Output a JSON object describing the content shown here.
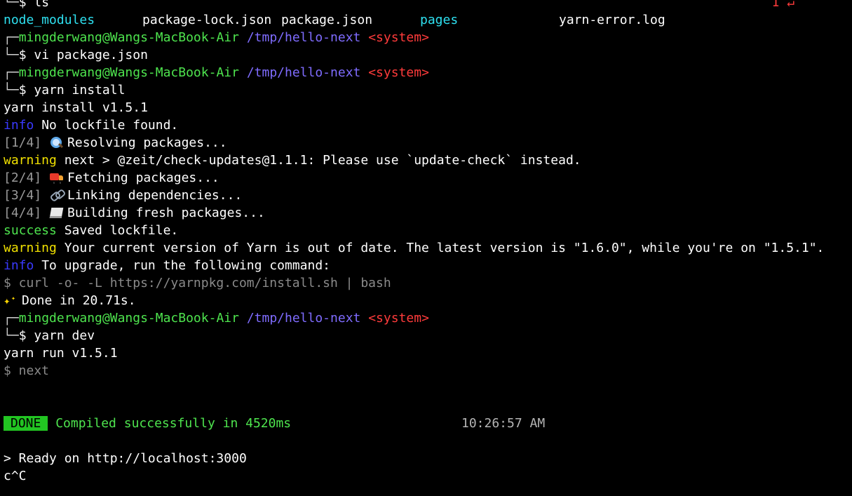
{
  "prompt": {
    "top": "┌─",
    "bottom": "└─",
    "dollar": "$",
    "user_host": "mingderwang@Wangs-MacBook-Air",
    "path": "/tmp/hello-next",
    "env": "<system>"
  },
  "lines": {
    "ls_cmd": "ls",
    "ls_exit": "1 ↵",
    "ls_output": {
      "node_modules": "node_modules",
      "package_lock": "package-lock.json",
      "package_json": "package.json",
      "pages": "pages",
      "yarn_error": "yarn-error.log"
    },
    "vi_cmd": "vi package.json",
    "yarn_install_cmd": "yarn install",
    "yarn_install_version": "yarn install v1.5.1",
    "info_label": "info",
    "no_lockfile": "No lockfile found.",
    "step1_tag": "[1/4]",
    "step1_text": "Resolving packages...",
    "warning_label": "warning",
    "warn_next": "next > @zeit/check-updates@1.1.1: Please use `update-check` instead.",
    "step2_tag": "[2/4]",
    "step2_text": "Fetching packages...",
    "step3_tag": "[3/4]",
    "step3_text": "Linking dependencies...",
    "step4_tag": "[4/4]",
    "step4_text": "Building fresh packages...",
    "success_label": "success",
    "saved_lockfile": "Saved lockfile.",
    "warn_yarn": "Your current version of Yarn is out of date. The latest version is \"1.6.0\", while you're on \"1.5.1\".",
    "info_upgrade": "To upgrade, run the following command:",
    "curl_cmd": "$ curl -o- -L https://yarnpkg.com/install.sh | bash",
    "done_text": "Done in 20.71s.",
    "yarn_dev_cmd": "yarn dev",
    "yarn_run_version": "yarn run v1.5.1",
    "next_cmd": "$ next",
    "done_badge": "DONE",
    "compiled": "Compiled successfully in 4520ms",
    "compiled_time": "10:26:57 AM",
    "ready": "> Ready on http://localhost:3000",
    "interrupt": "c^C"
  },
  "colors": {
    "background": "#000000",
    "user_host": "#4ee44e",
    "path": "#7f6cff",
    "env": "#ff3b3b",
    "directory": "#2ee0f0",
    "info": "#3a3aff",
    "warning": "#f0e000",
    "success": "#4ee44e",
    "done_badge": "#22c522"
  },
  "icons": {
    "step1": "magnifying-glass-icon",
    "step2": "delivery-truck-icon",
    "step3": "link-icon",
    "step4": "page-icon",
    "done": "sparkles-icon"
  }
}
